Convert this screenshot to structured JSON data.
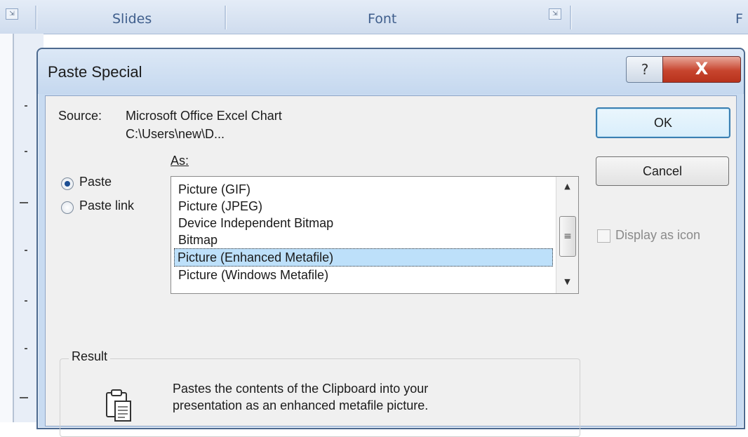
{
  "ribbon": {
    "groups": [
      "Slides",
      "Font"
    ],
    "cut_off_letter": "F",
    "launcher_glyph": "⇲"
  },
  "dialog": {
    "title": "Paste Special",
    "help_glyph": "?",
    "close_glyph": "X",
    "source_label": "Source:",
    "source_value": "Microsoft Office Excel Chart",
    "source_path": "C:\\Users\\new\\D...",
    "as_label": "As:",
    "paste_label": "Paste",
    "paste_link_label": "Paste link",
    "paste_selected": true,
    "formats": [
      "Picture (GIF)",
      "Picture (JPEG)",
      "Device Independent Bitmap",
      "Bitmap",
      "Picture (Enhanced Metafile)",
      "Picture (Windows Metafile)"
    ],
    "selected_format": "Picture (Enhanced Metafile)",
    "ok_label": "OK",
    "cancel_label": "Cancel",
    "display_as_icon_label": "Display as icon",
    "display_as_icon_checked": false,
    "result_title": "Result",
    "result_line1": "Pastes the contents of the Clipboard into your",
    "result_line2": "presentation as an enhanced metafile picture.",
    "result_icon": "clipboard-icon"
  },
  "colors": {
    "selection": "#bde0fa",
    "close_button": "#c7452e",
    "frame": "#c8dbf1"
  }
}
